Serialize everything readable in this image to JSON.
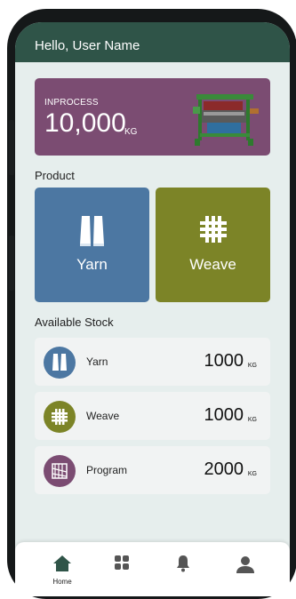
{
  "header": {
    "greeting": "Hello, User Name"
  },
  "inprocess": {
    "label": "INPROCESS",
    "value": "10,000",
    "unit": "KG",
    "icon": "loom-icon"
  },
  "product": {
    "title": "Product",
    "tiles": [
      {
        "label": "Yarn",
        "color": "#4c77a2",
        "icon": "yarn-spools-icon"
      },
      {
        "label": "Weave",
        "color": "#7c8427",
        "icon": "weave-pattern-icon"
      }
    ]
  },
  "stock": {
    "title": "Available Stock",
    "items": [
      {
        "name": "Yarn",
        "value": "1000",
        "unit": "KG",
        "color": "#4c77a2",
        "icon": "yarn-spools-icon"
      },
      {
        "name": "Weave",
        "value": "1000",
        "unit": "KG",
        "color": "#7c8427",
        "icon": "weave-pattern-icon"
      },
      {
        "name": "Program",
        "value": "2000",
        "unit": "KG",
        "color": "#7b4c72",
        "icon": "program-pattern-icon"
      }
    ]
  },
  "nav": {
    "home_label": "Home",
    "items": [
      "home-icon",
      "grid-icon",
      "bell-icon",
      "user-icon"
    ]
  },
  "colors": {
    "header": "#2f5448",
    "background": "#e6eeed",
    "inprocess": "#7b4c72"
  }
}
